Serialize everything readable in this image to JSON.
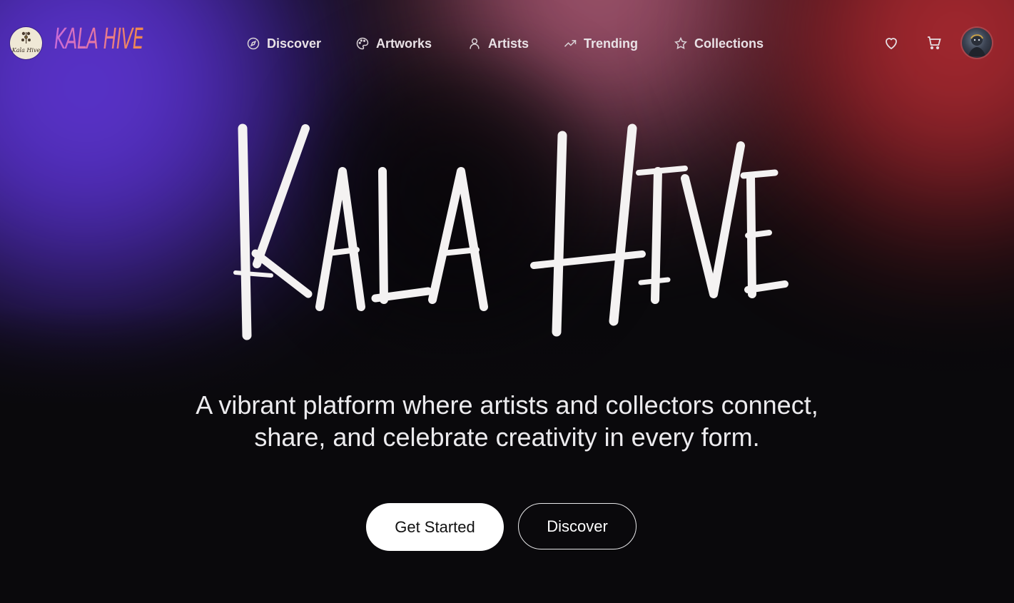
{
  "brand": {
    "name": "Kala Hive",
    "wordmark": "KALA HIVE",
    "badge_text": "Kala Hive"
  },
  "nav": {
    "items": [
      {
        "label": "Discover",
        "icon": "compass-icon"
      },
      {
        "label": "Artworks",
        "icon": "palette-icon"
      },
      {
        "label": "Artists",
        "icon": "user-icon"
      },
      {
        "label": "Trending",
        "icon": "trending-up-icon"
      },
      {
        "label": "Collections",
        "icon": "star-icon"
      }
    ]
  },
  "header_actions": {
    "favorites_icon": "heart-icon",
    "cart_icon": "cart-icon",
    "avatar": "user-avatar"
  },
  "hero": {
    "title": "KALA HIVE",
    "tagline_line1": "A vibrant platform where artists and collectors connect,",
    "tagline_line2": "share, and celebrate creativity in every form.",
    "primary_cta": "Get Started",
    "secondary_cta": "Discover"
  },
  "colors": {
    "background": "#0a090c",
    "glow_purple": "#6a3ee6",
    "glow_pink": "#c06e86",
    "glow_red": "#c8343a",
    "text": "#ecebee",
    "button_bg": "#ffffff"
  }
}
